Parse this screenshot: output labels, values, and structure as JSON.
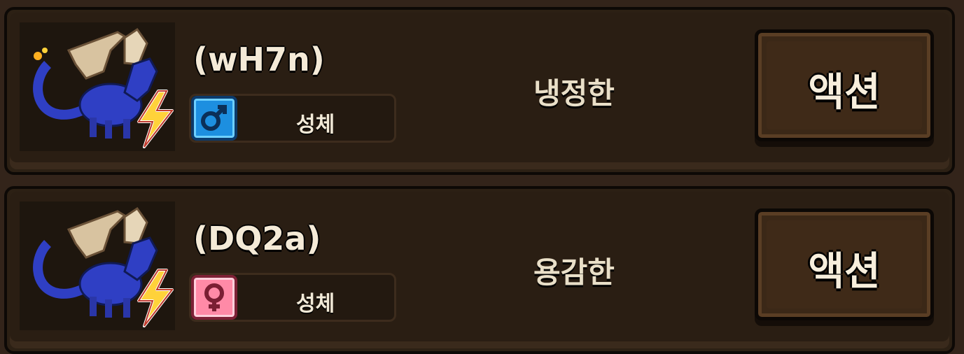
{
  "colors": {
    "male": "#1d8fe0",
    "female": "#ff8aa7",
    "dragon_body": "#2f3fc4",
    "dragon_wing": "#d8c3a0",
    "element_bolt": "#ffd23a"
  },
  "creatures": [
    {
      "name": "(wH7n)",
      "gender_icon": "male-icon",
      "stage": "성체",
      "temperament": "냉정한",
      "action_label": "액션",
      "element_icon": "lightning-icon"
    },
    {
      "name": "(DQ2a)",
      "gender_icon": "female-icon",
      "stage": "성체",
      "temperament": "용감한",
      "action_label": "액션",
      "element_icon": "lightning-icon"
    }
  ]
}
